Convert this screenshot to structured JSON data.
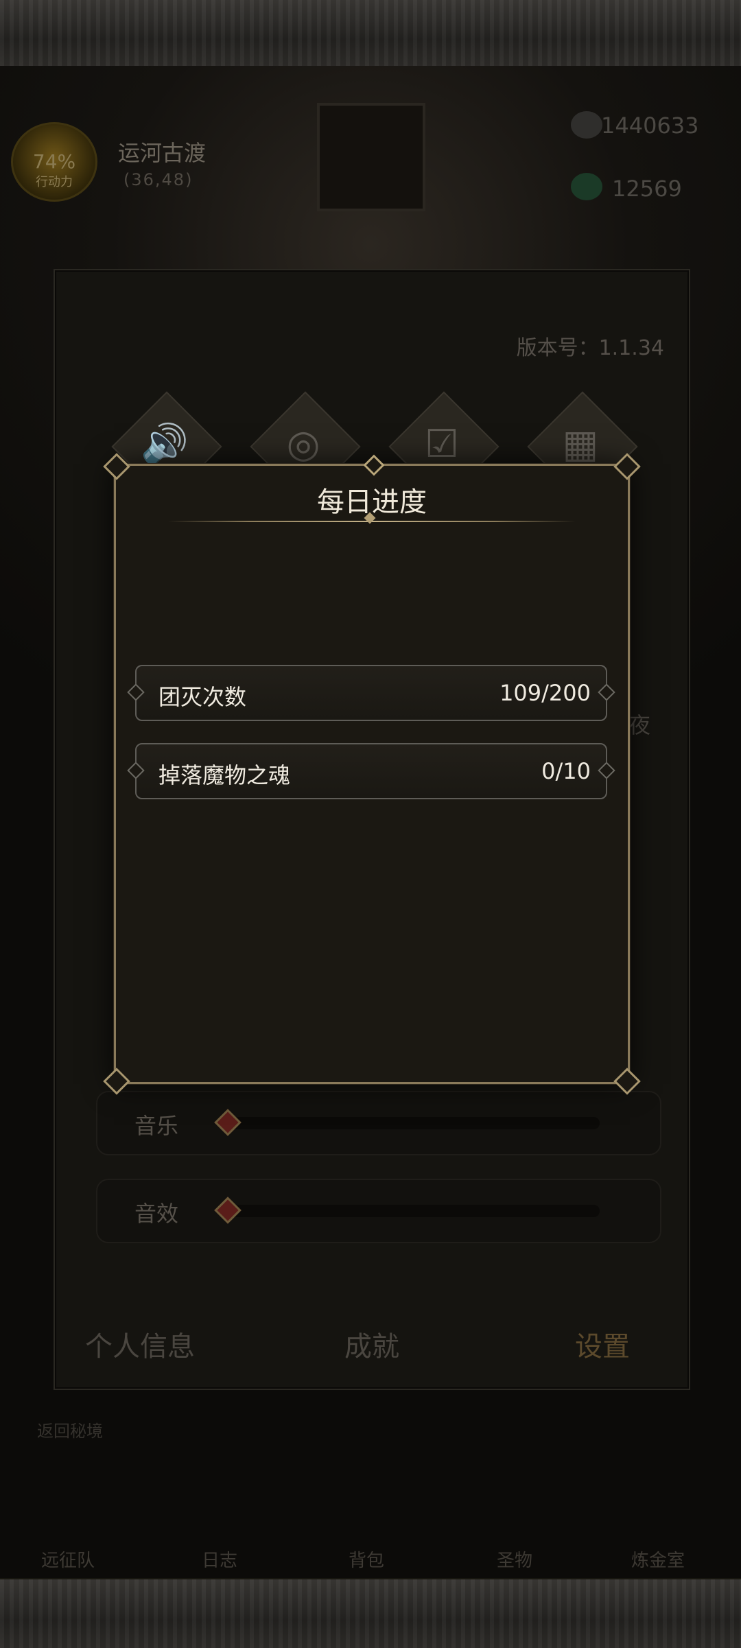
{
  "hud": {
    "percent": "74%",
    "badge_sub": "行动力",
    "location_name": "运河古渡",
    "location_coords": "(36,48)",
    "currency_1": "1440633",
    "currency_2": "12569"
  },
  "settings": {
    "version_label": "版本号：1.1.34",
    "side_label": "夜",
    "faint_label": "声音",
    "music_label": "音乐",
    "sfx_label": "音效",
    "tabs": [
      "个人信息",
      "成就",
      "设置"
    ]
  },
  "bottom_nav": [
    "远征队",
    "日志",
    "背包",
    "圣物",
    "炼金室"
  ],
  "side_return": "返回秘境",
  "modal": {
    "title": "每日进度",
    "rows": [
      {
        "name": "团灭次数",
        "value": "109/200"
      },
      {
        "name": "掉落魔物之魂",
        "value": "0/10"
      }
    ]
  },
  "colors": {
    "modal_border": "#8a7a5a",
    "modal_bg": "#1b1812",
    "row_border": "#5e5c57",
    "text_light": "#f0ebe0"
  }
}
